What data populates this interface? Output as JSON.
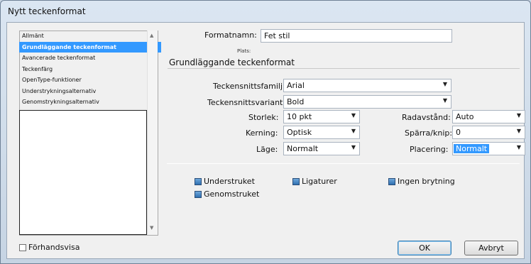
{
  "window": {
    "title": "Nytt teckenformat"
  },
  "categories": [
    {
      "label": "Allmänt",
      "selected": false
    },
    {
      "label": "Grundläggande teckenformat",
      "selected": true
    },
    {
      "label": "Avancerade teckenformat",
      "selected": false
    },
    {
      "label": "Teckenfärg",
      "selected": false
    },
    {
      "label": "OpenType-funktioner",
      "selected": false
    },
    {
      "label": "Understrykningsalternativ",
      "selected": false
    },
    {
      "label": "Genomstrykningsalternativ",
      "selected": false
    }
  ],
  "format_name": {
    "label": "Formatnamn:",
    "value": "Fet stil"
  },
  "location": {
    "label": "Plats:"
  },
  "section": {
    "title": "Grundläggande teckenformat"
  },
  "fields": {
    "font_family": {
      "label": "Teckensnittsfamilj:",
      "value": "Arial"
    },
    "font_style": {
      "label": "Teckensnittsvariant:",
      "value": "Bold"
    },
    "size": {
      "label": "Storlek:",
      "value": "10 pkt"
    },
    "leading": {
      "label": "Radavstånd:",
      "value": "Auto"
    },
    "kerning": {
      "label": "Kerning:",
      "value": "Optisk"
    },
    "tracking": {
      "label": "Spärra/knip:",
      "value": "0"
    },
    "case": {
      "label": "Läge:",
      "value": "Normalt"
    },
    "position": {
      "label": "Placering:",
      "value": "Normalt"
    }
  },
  "options": {
    "underline": {
      "label": "Understruket",
      "checked": true
    },
    "ligatures": {
      "label": "Ligaturer",
      "checked": true
    },
    "no_break": {
      "label": "Ingen brytning",
      "checked": true
    },
    "strikethrough": {
      "label": "Genomstruket",
      "checked": true
    }
  },
  "preview": {
    "label": "Förhandsvisa",
    "checked": false
  },
  "buttons": {
    "ok": "OK",
    "cancel": "Avbryt"
  },
  "icons": {
    "dropdown": "chevron-down-icon",
    "scroll_up": "scroll-up-icon",
    "scroll_down": "scroll-down-icon"
  }
}
